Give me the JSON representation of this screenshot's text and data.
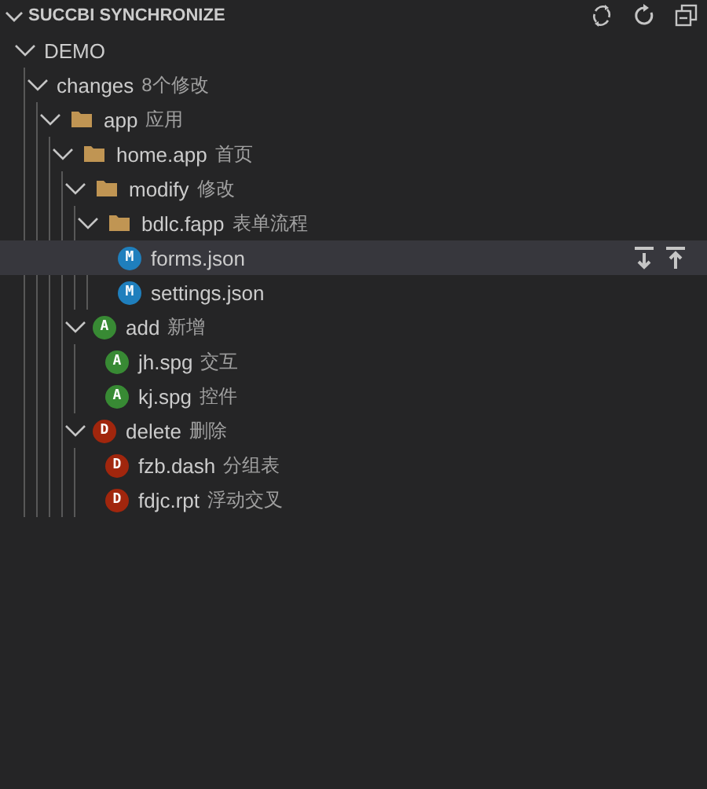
{
  "header": {
    "title": "SUCCBI SYNCHRONIZE",
    "expanded": true
  },
  "tree": [
    {
      "label": "DEMO",
      "expanded": true,
      "selected": false,
      "children": [
        {
          "label": "changes",
          "description": "8个修改",
          "expanded": true,
          "selected": false,
          "children": [
            {
              "kind": "folder",
              "label": "app",
              "description": "应用",
              "expanded": true,
              "selected": false,
              "children": [
                {
                  "kind": "folder",
                  "label": "home.app",
                  "description": "首页",
                  "expanded": true,
                  "selected": false,
                  "children": [
                    {
                      "kind": "folder",
                      "label": "modify",
                      "description": "修改",
                      "expanded": true,
                      "selected": false,
                      "children": [
                        {
                          "kind": "folder",
                          "label": "bdlc.fapp",
                          "description": "表单流程",
                          "expanded": true,
                          "selected": false,
                          "children": [
                            {
                              "kind": "status",
                              "badge": "M",
                              "color": "#1f7fbd",
                              "label": "forms.json",
                              "selected": true
                            },
                            {
                              "kind": "status",
                              "badge": "M",
                              "color": "#1f7fbd",
                              "label": "settings.json",
                              "selected": false
                            }
                          ]
                        }
                      ]
                    },
                    {
                      "kind": "status",
                      "badge": "A",
                      "color": "#388a34",
                      "label": "add",
                      "description": "新增",
                      "expanded": true,
                      "selected": false,
                      "children": [
                        {
                          "kind": "status",
                          "badge": "A",
                          "color": "#388a34",
                          "label": "jh.spg",
                          "description": "交互",
                          "selected": false
                        },
                        {
                          "kind": "status",
                          "badge": "A",
                          "color": "#388a34",
                          "label": "kj.spg",
                          "description": "控件",
                          "selected": false
                        }
                      ]
                    },
                    {
                      "kind": "status",
                      "badge": "D",
                      "color": "#a1260d",
                      "label": "delete",
                      "description": "删除",
                      "expanded": true,
                      "selected": false,
                      "children": [
                        {
                          "kind": "status",
                          "badge": "D",
                          "color": "#a1260d",
                          "label": "fzb.dash",
                          "description": "分组表",
                          "selected": false
                        },
                        {
                          "kind": "status",
                          "badge": "D",
                          "color": "#a1260d",
                          "label": "fdjc.rpt",
                          "description": "浮动交叉",
                          "selected": false
                        }
                      ]
                    }
                  ]
                }
              ]
            }
          ]
        }
      ]
    }
  ]
}
